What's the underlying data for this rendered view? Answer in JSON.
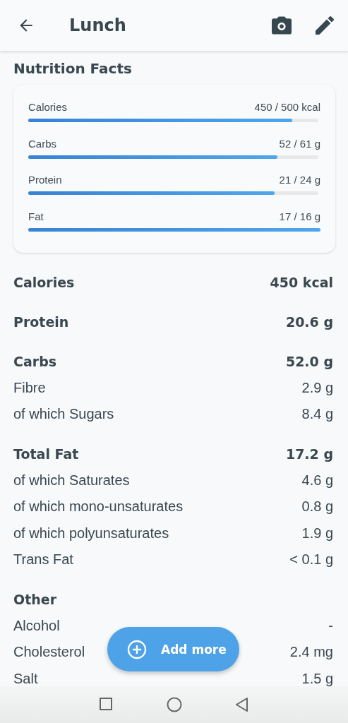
{
  "app_bar": {
    "title": "Lunch"
  },
  "section_title": "Nutrition Facts",
  "meters": [
    {
      "label": "Calories",
      "reading": "450 / 500 kcal",
      "level": 0.91
    },
    {
      "label": "Carbs",
      "reading": "52 / 61 g",
      "level": 0.86
    },
    {
      "label": "Protein",
      "reading": "21 / 24 g",
      "level": 0.85
    },
    {
      "label": "Fat",
      "reading": "17 / 16 g",
      "level": 1.0
    }
  ],
  "groups": [
    {
      "rows": [
        {
          "kind": "total",
          "name": "Calories",
          "value": "450 kcal"
        }
      ]
    },
    {
      "rows": [
        {
          "kind": "total",
          "name": "Protein",
          "value": "20.6 g"
        }
      ]
    },
    {
      "rows": [
        {
          "kind": "total",
          "name": "Carbs",
          "value": "52.0 g"
        },
        {
          "kind": "sub",
          "name": "Fibre",
          "value": "2.9 g"
        },
        {
          "kind": "sub",
          "name": "of which Sugars",
          "value": "8.4 g"
        }
      ]
    },
    {
      "rows": [
        {
          "kind": "total",
          "name": "Total Fat",
          "value": "17.2 g"
        },
        {
          "kind": "sub",
          "name": "of which Saturates",
          "value": "4.6 g"
        },
        {
          "kind": "sub",
          "name": "of which mono-unsaturates",
          "value": "0.8 g"
        },
        {
          "kind": "sub",
          "name": "of which polyunsaturates",
          "value": "1.9 g"
        },
        {
          "kind": "sub",
          "name": "Trans Fat",
          "value": "< 0.1 g"
        }
      ]
    },
    {
      "rows": [
        {
          "kind": "total",
          "name": "Other"
        },
        {
          "kind": "sub",
          "name": "Alcohol",
          "value": "-"
        },
        {
          "kind": "sub",
          "name": "Cholesterol",
          "value": "2.4 mg"
        },
        {
          "kind": "sub",
          "name": "Salt",
          "value": "1.5 g"
        }
      ]
    }
  ],
  "fab": {
    "label": "Add more"
  }
}
